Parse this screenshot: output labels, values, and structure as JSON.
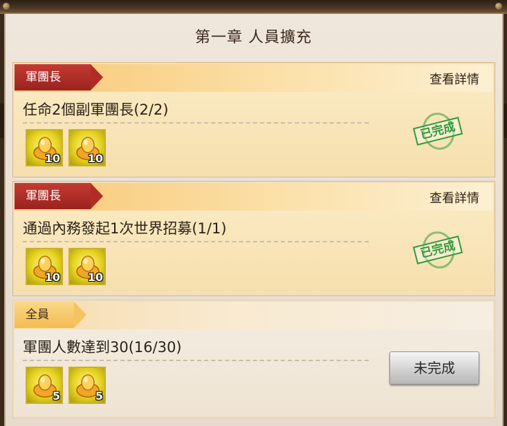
{
  "chapter_title": "第一章 人員擴充",
  "tasks": [
    {
      "tag": "軍團長",
      "details_label": "查看詳情",
      "description": "任命2個副軍團長(2/2)",
      "rewards": [
        {
          "icon": "gold-ingot-icon",
          "count": "10"
        },
        {
          "icon": "gold-ingot-icon",
          "count": "10"
        }
      ],
      "status_stamp": "已完成"
    },
    {
      "tag": "軍團長",
      "details_label": "查看詳情",
      "description": "通過內務發起1次世界招募(1/1)",
      "rewards": [
        {
          "icon": "gold-ingot-icon",
          "count": "10"
        },
        {
          "icon": "gold-ingot-icon",
          "count": "10"
        }
      ],
      "status_stamp": "已完成"
    },
    {
      "tag": "全員",
      "description": "軍團人數達到30(16/30)",
      "rewards": [
        {
          "icon": "gold-ingot-icon",
          "count": "5"
        },
        {
          "icon": "gold-ingot-icon",
          "count": "5"
        }
      ],
      "status_button": "未完成"
    }
  ],
  "colors": {
    "tag_red": "#b02c27",
    "tag_gold": "#f2bb4e",
    "stamp_green": "#2f9a3a"
  }
}
